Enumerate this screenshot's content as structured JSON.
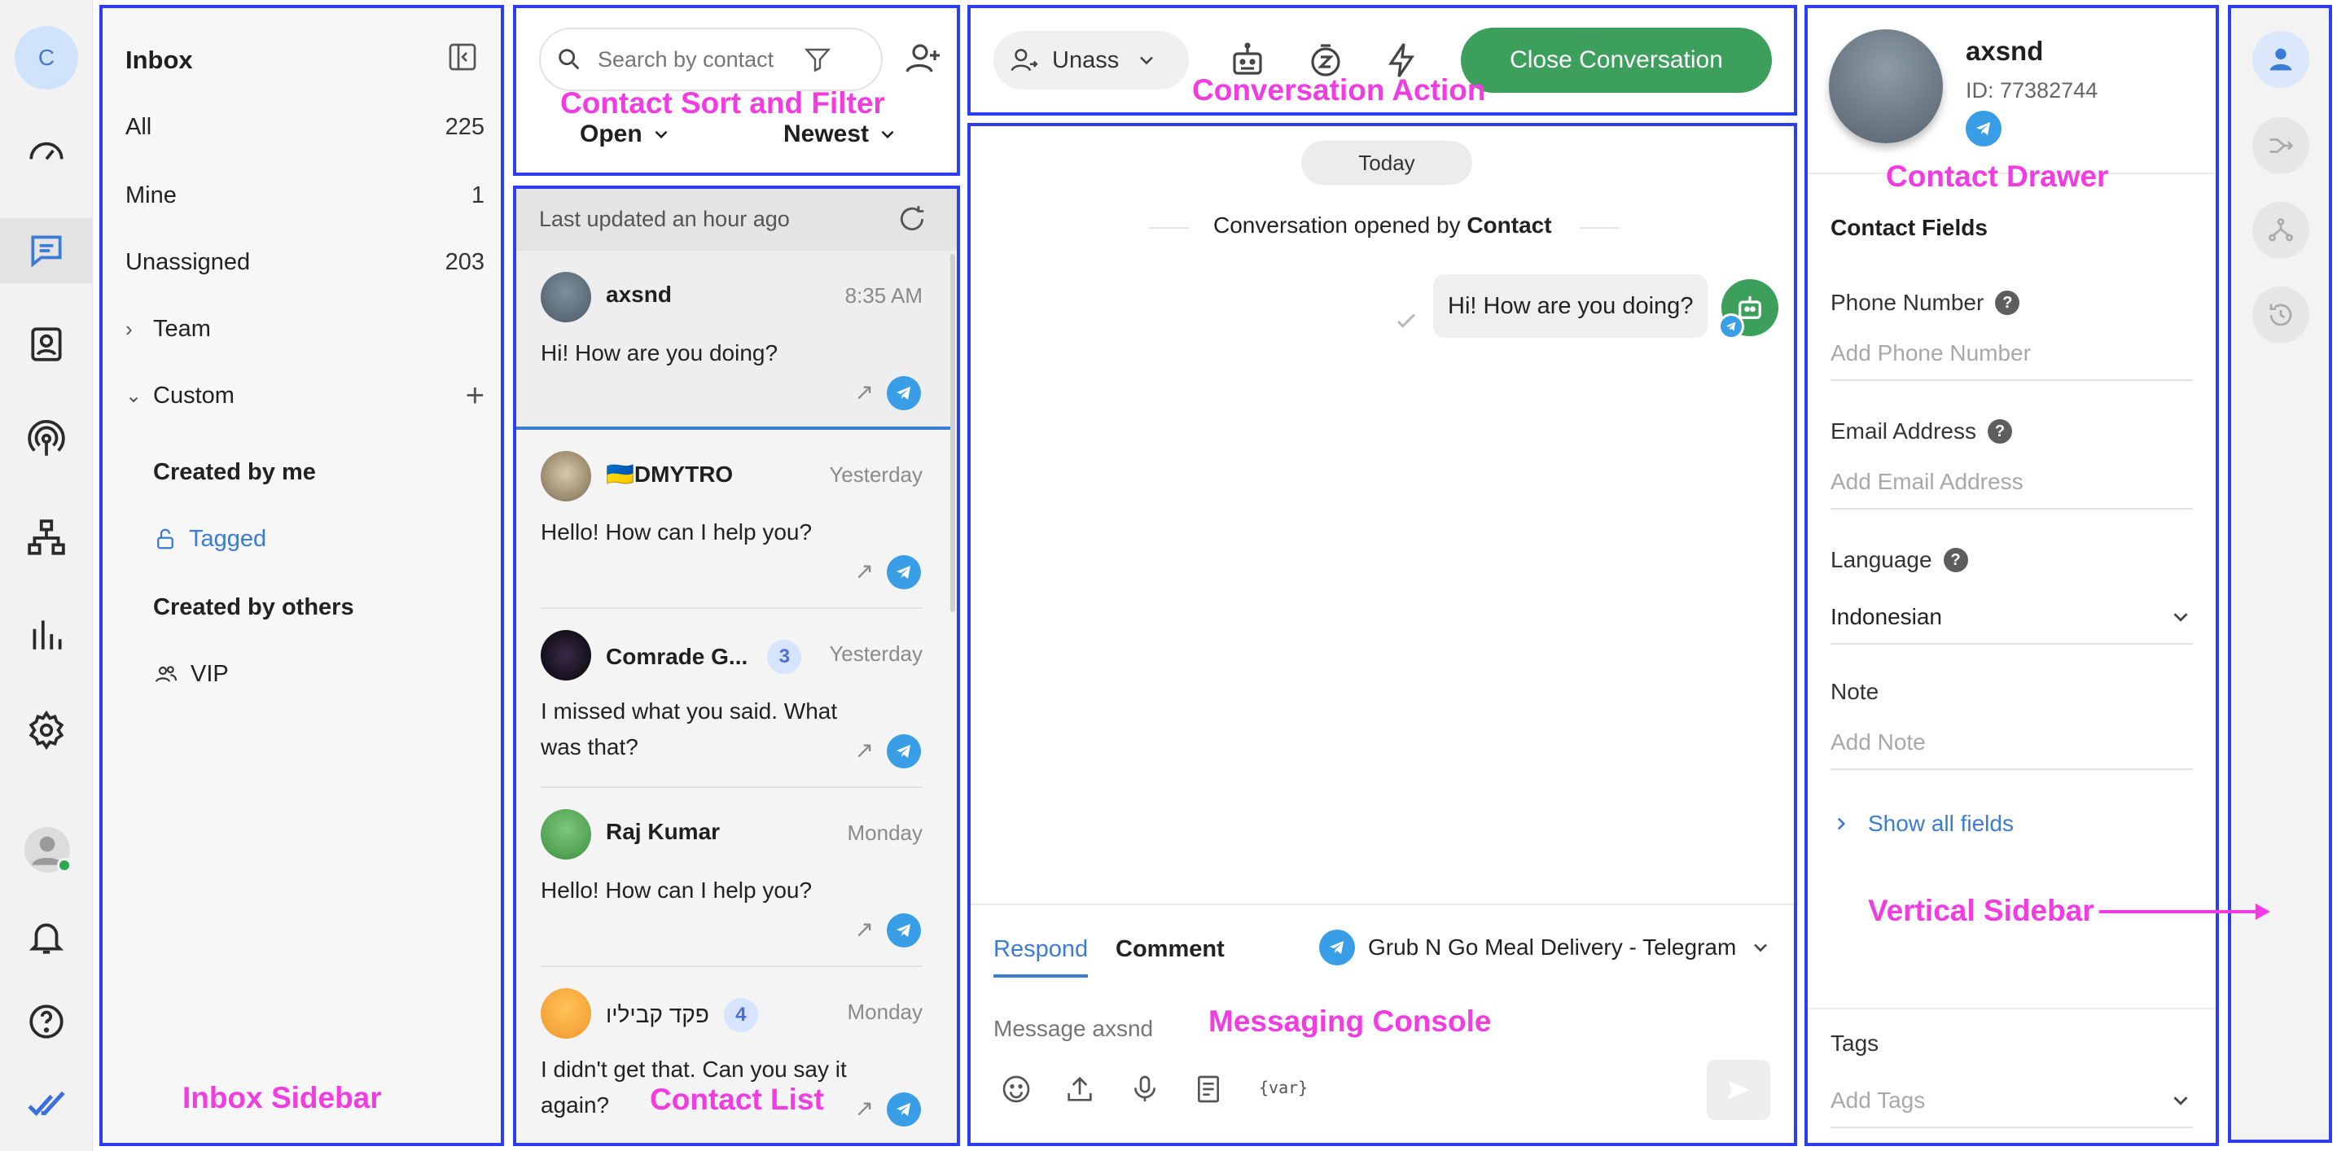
{
  "rail": {
    "avatar_letter": "C",
    "icons": [
      "dashboard-icon",
      "conversations-icon",
      "contacts-icon",
      "broadcast-icon",
      "workflows-icon",
      "reports-icon",
      "settings-icon"
    ],
    "bottom_icons": [
      "user-avatar",
      "notifications-icon",
      "help-icon",
      "logo-icon"
    ]
  },
  "inbox": {
    "title": "Inbox",
    "items": [
      {
        "label": "All",
        "count": "225"
      },
      {
        "label": "Mine",
        "count": "1"
      },
      {
        "label": "Unassigned",
        "count": "203"
      }
    ],
    "team_label": "Team",
    "custom_label": "Custom",
    "custom_items": [
      {
        "label": "Created by me"
      },
      {
        "label": "Tagged"
      },
      {
        "label": "Created by others"
      },
      {
        "label": "VIP"
      }
    ]
  },
  "contact_filter": {
    "search_placeholder": "Search by contact",
    "status": "Open",
    "sort": "Newest"
  },
  "contact_list": {
    "updated_text": "Last updated an hour ago",
    "items": [
      {
        "name": "axsnd",
        "time": "8:35 AM",
        "message": "Hi! How are you doing?",
        "badge": ""
      },
      {
        "name": "🇺🇦DMYTRO",
        "time": "Yesterday",
        "message": "Hello! How can I help you?",
        "badge": ""
      },
      {
        "name": "Comrade G...",
        "time": "Yesterday",
        "message": "I missed what you said. What was that?",
        "badge": "3"
      },
      {
        "name": "Raj Kumar",
        "time": "Monday",
        "message": "Hello! How can I help you?",
        "badge": ""
      },
      {
        "name": "פקד קביליו",
        "time": "Monday",
        "message": "I didn't get that. Can you say it again?",
        "badge": "4"
      }
    ]
  },
  "conversation_action": {
    "assignee": "Unass",
    "close_label": "Close Conversation"
  },
  "conversation": {
    "date_chip": "Today",
    "opened_prefix": "Conversation opened by ",
    "opened_by": "Contact",
    "messages": [
      {
        "text": "Hi! How are you doing?"
      }
    ]
  },
  "console": {
    "tab_respond": "Respond",
    "tab_comment": "Comment",
    "channel": "Grub N Go Meal Delivery - Telegram",
    "placeholder": "Message axsnd",
    "var_label": "{var}"
  },
  "drawer": {
    "name": "axsnd",
    "id_text": "ID: 77382744",
    "fields_title": "Contact Fields",
    "phone_label": "Phone Number",
    "phone_placeholder": "Add Phone Number",
    "email_label": "Email Address",
    "email_placeholder": "Add Email Address",
    "language_label": "Language",
    "language_value": "Indonesian",
    "note_label": "Note",
    "note_placeholder": "Add Note",
    "show_all": "Show all fields",
    "tags_label": "Tags",
    "tags_placeholder": "Add Tags"
  },
  "annotations": {
    "inbox_sidebar": "Inbox Sidebar",
    "contact_sort_filter": "Contact Sort and Filter",
    "contact_list": "Contact List",
    "conversation_action": "Conversation Action",
    "messaging_console": "Messaging Console",
    "contact_drawer": "Contact Drawer",
    "vertical_sidebar": "Vertical Sidebar"
  },
  "colors": {
    "accent_blue": "#3a7bd5",
    "telegram_blue": "#3a9ee6",
    "close_green": "#3c9f5b",
    "annotation_pink": "#f13ce2",
    "annotation_box": "#2d3ef0"
  }
}
